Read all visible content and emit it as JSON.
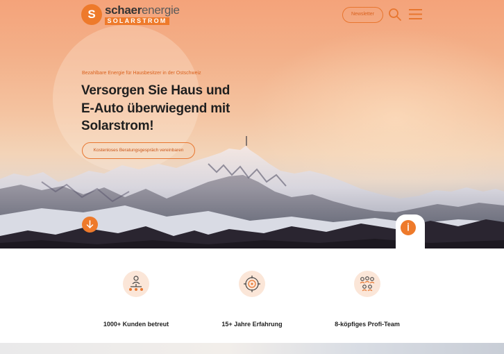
{
  "brand": {
    "logo_mark": "S",
    "name_bold": "schaer",
    "name_light": "energie",
    "subline": "SOLARSTROM",
    "accent_color": "#ee7a2b"
  },
  "header": {
    "newsletter_label": "Newsletter",
    "search_icon": "search-icon",
    "menu_icon": "hamburger-menu-icon"
  },
  "hero": {
    "eyebrow": "Bezahlbare Energie für Hausbesitzer in der Ostschweiz",
    "headline_line1": "Versorgen Sie Haus und",
    "headline_line2": "E-Auto überwiegend mit",
    "headline_line3": "Solarstrom!",
    "cta_label": "Kostenloses Beratungsgespräch vereinbaren",
    "scroll_icon": "arrow-down-icon",
    "info_icon": "info-icon"
  },
  "features": [
    {
      "icon": "hierarchy-people-icon",
      "label": "1000+ Kunden betreut"
    },
    {
      "icon": "target-coin-icon",
      "label": "15+ Jahre Erfahrung"
    },
    {
      "icon": "team-group-icon",
      "label": "8-köpfiges Profi-Team"
    }
  ]
}
